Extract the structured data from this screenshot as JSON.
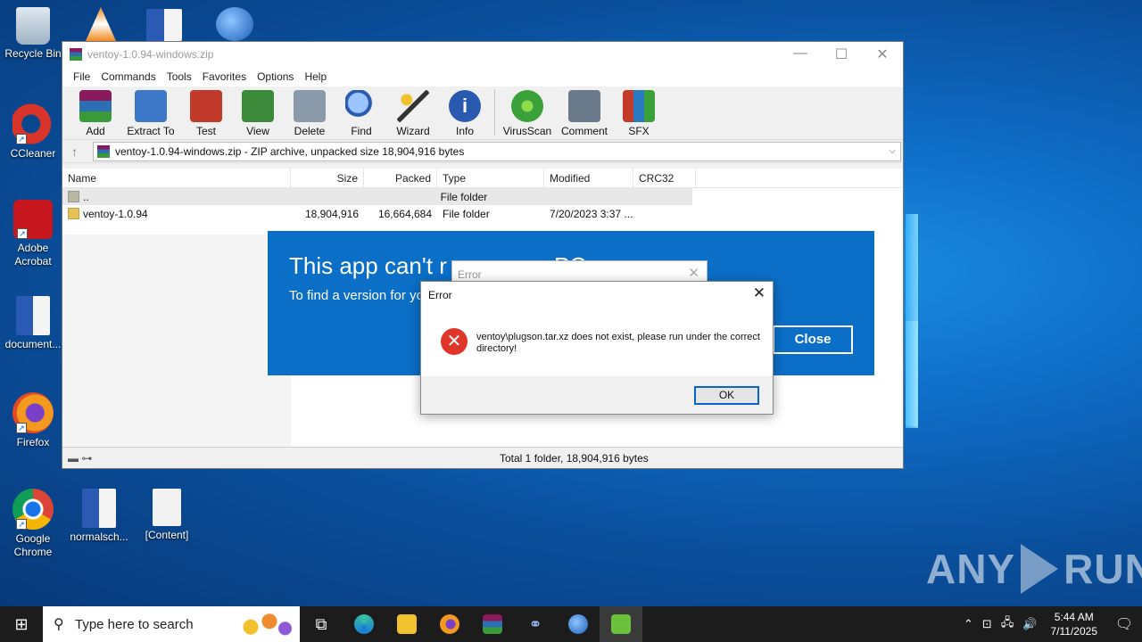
{
  "desktop": {
    "icons": [
      {
        "label": "Recycle Bin",
        "icon": "recycle-bin-icon"
      },
      {
        "label": "CCleaner",
        "icon": "ccleaner-icon"
      },
      {
        "label": "Adobe Acrobat",
        "icon": "acrobat-icon"
      },
      {
        "label": "document...",
        "icon": "word-document-icon"
      },
      {
        "label": "Firefox",
        "icon": "firefox-icon"
      },
      {
        "label": "Google Chrome",
        "icon": "chrome-icon"
      },
      {
        "label": "normalsch...",
        "icon": "word-document-icon"
      },
      {
        "label": "[Content]",
        "icon": "blank-file-icon"
      }
    ]
  },
  "winrar": {
    "title": "ventoy-1.0.94-windows.zip",
    "menu": [
      "File",
      "Commands",
      "Tools",
      "Favorites",
      "Options",
      "Help"
    ],
    "toolbar": [
      {
        "label": "Add",
        "icon": "add-archive-icon",
        "color": "#7a3c1a"
      },
      {
        "label": "Extract To",
        "icon": "extract-folder-icon",
        "color": "#3e79c9"
      },
      {
        "label": "Test",
        "icon": "test-clipboard-icon",
        "color": "#c23a2a"
      },
      {
        "label": "View",
        "icon": "view-book-icon",
        "color": "#3a8a3a"
      },
      {
        "label": "Delete",
        "icon": "delete-bin-icon",
        "color": "#8a9aaa"
      },
      {
        "label": "Find",
        "icon": "find-magnifier-icon",
        "color": "#3a6ab8"
      },
      {
        "label": "Wizard",
        "icon": "wizard-wand-icon",
        "color": "#5a8a3a"
      },
      {
        "label": "Info",
        "icon": "info-icon",
        "color": "#2a5ab0"
      },
      {
        "label": "VirusScan",
        "icon": "virus-scan-icon",
        "color": "#3aa03a"
      },
      {
        "label": "Comment",
        "icon": "comment-icon",
        "color": "#6a7a8a"
      },
      {
        "label": "SFX",
        "icon": "sfx-books-icon",
        "color": "#c25a2a"
      }
    ],
    "address": "ventoy-1.0.94-windows.zip - ZIP archive, unpacked size 18,904,916 bytes",
    "columns": [
      "Name",
      "Size",
      "Packed",
      "Type",
      "Modified",
      "CRC32"
    ],
    "rows": [
      {
        "name": "..",
        "size": "",
        "packed": "",
        "type": "File folder",
        "modified": "",
        "crc": ""
      },
      {
        "name": "ventoy-1.0.94",
        "size": "18,904,916",
        "packed": "16,664,684",
        "type": "File folder",
        "modified": "7/20/2023 3:37 ...",
        "crc": ""
      }
    ],
    "status": "Total 1 folder, 18,904,916 bytes"
  },
  "blue_dialog": {
    "title": "This app can't r",
    "title_tail": "PC",
    "subtitle": "To find a version for yo",
    "close_label": "Close"
  },
  "error_back": {
    "title": "Error"
  },
  "error_front": {
    "title": "Error",
    "message": "ventoy\\plugson.tar.xz does not exist, please run under the correct directory!",
    "ok_label": "OK"
  },
  "watermark": {
    "left": "ANY",
    "right": "RUN"
  },
  "taskbar": {
    "search_placeholder": "Type here to search",
    "time": "5:44 AM",
    "date": "7/11/2025"
  }
}
